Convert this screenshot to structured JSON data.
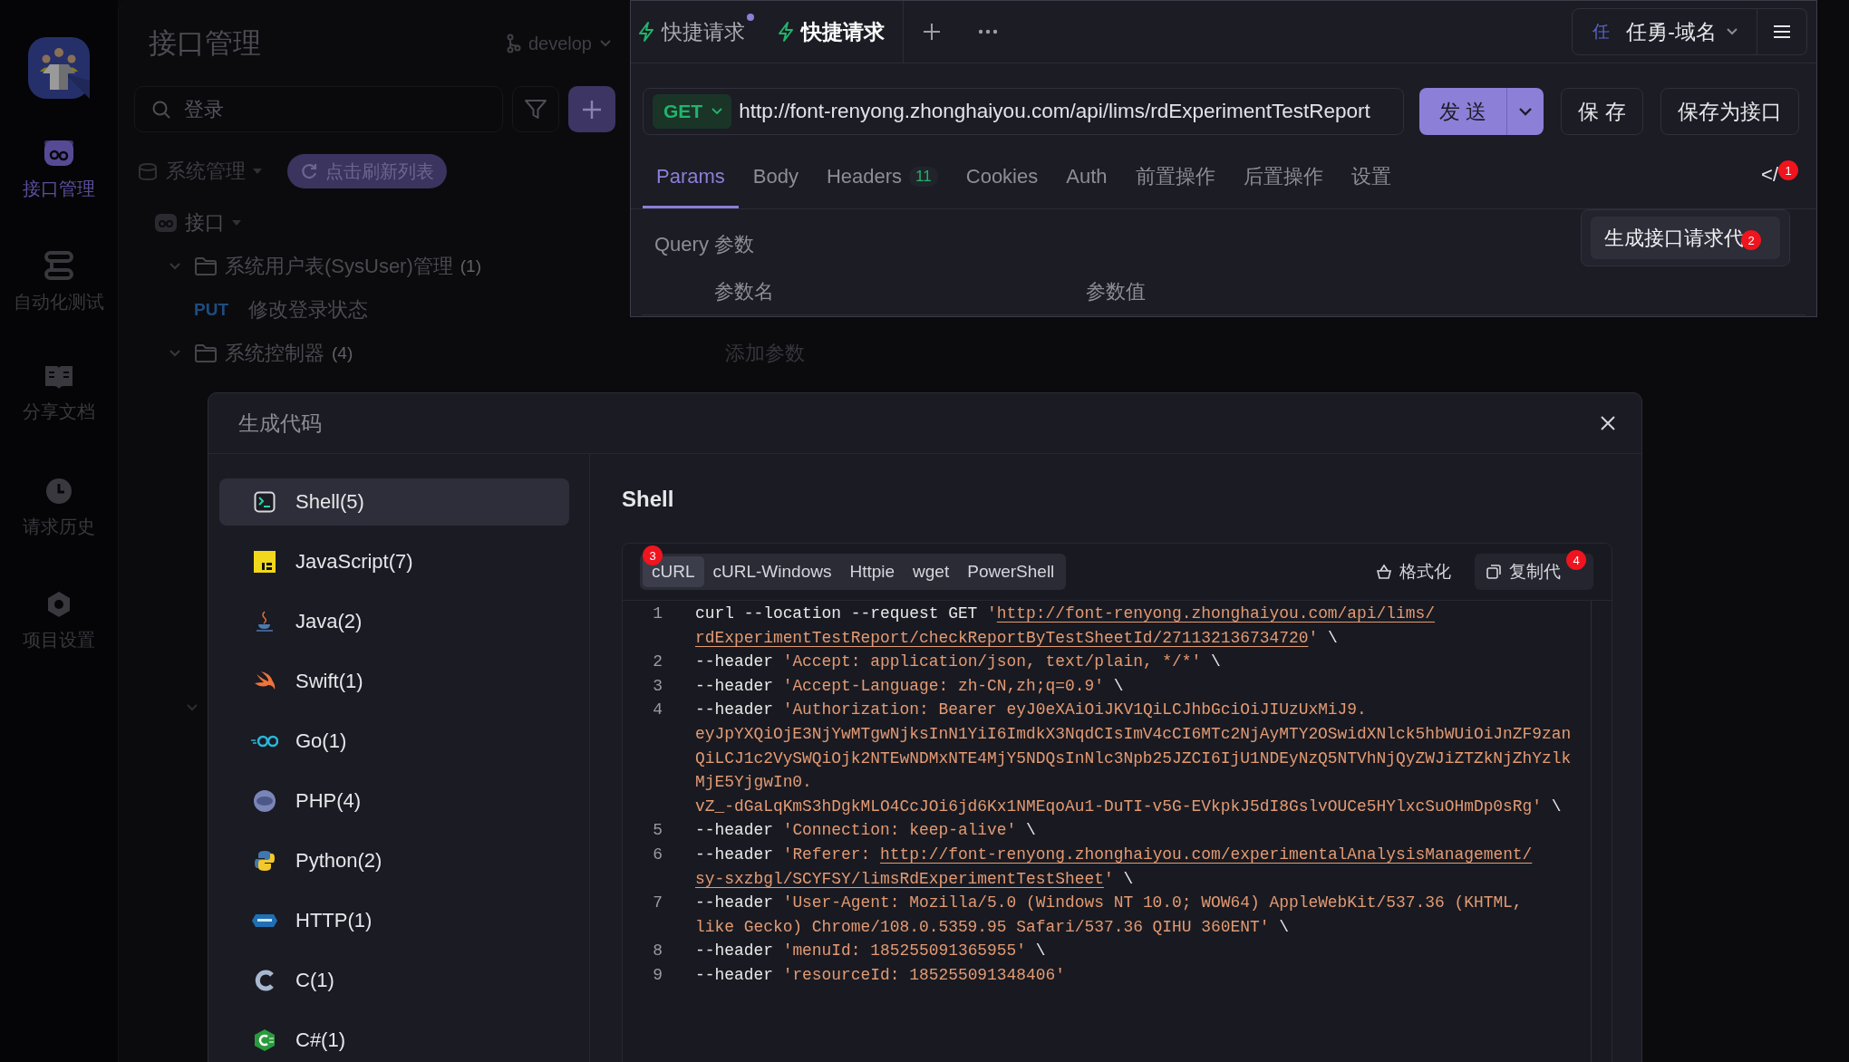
{
  "nav": {
    "items": [
      {
        "label": "接口管理",
        "kind": "api",
        "selected": true
      },
      {
        "label": "自动化测试",
        "kind": "automation",
        "selected": false
      },
      {
        "label": "分享文档",
        "kind": "docs",
        "selected": false
      },
      {
        "label": "请求历史",
        "kind": "history",
        "selected": false
      },
      {
        "label": "项目设置",
        "kind": "settings",
        "selected": false
      }
    ]
  },
  "tree_panel": {
    "title": "接口管理",
    "branch": "develop",
    "search": {
      "value": "登录"
    },
    "group": "系统管理",
    "refresh_button": "点击刷新列表",
    "root": "接口",
    "folders": [
      {
        "name": "系统用户表(SysUser)管理",
        "count": "(1)",
        "expanded": true,
        "children": [
          {
            "method": "PUT",
            "name": "修改登录状态"
          }
        ]
      },
      {
        "name": "系统控制器",
        "count": "(4)",
        "expanded": true
      }
    ]
  },
  "request": {
    "tabs": [
      {
        "label": "快捷请求",
        "selected": false,
        "unsaved": true
      },
      {
        "label": "快捷请求",
        "selected": true,
        "unsaved": false
      }
    ],
    "environment": {
      "avatar": "任",
      "name": "任勇-域名"
    },
    "method": "GET",
    "url": "http://font-renyong.zhonghaiyou.com/api/lims/rdExperimentTestReport",
    "send": "发 送",
    "save": "保 存",
    "save_as": "保存为接口",
    "param_tabs": [
      {
        "label": "Params",
        "selected": true
      },
      {
        "label": "Body",
        "selected": false
      },
      {
        "label": "Headers",
        "badge": "11",
        "selected": false
      },
      {
        "label": "Cookies",
        "selected": false
      },
      {
        "label": "Auth",
        "selected": false
      },
      {
        "label": "前置操作",
        "selected": false
      },
      {
        "label": "后置操作",
        "selected": false
      },
      {
        "label": "设置",
        "selected": false
      }
    ],
    "code_button": "</",
    "code_badge": "1",
    "menu_item": "生成接口请求代",
    "menu_badge": "2",
    "query_title": "Query 参数",
    "columns": [
      "参数名",
      "参数值"
    ],
    "add_param": "添加参数"
  },
  "modal": {
    "title": "生成代码",
    "languages": [
      {
        "label": "Shell(5)",
        "kind": "shell",
        "selected": true
      },
      {
        "label": "JavaScript(7)",
        "kind": "js",
        "selected": false
      },
      {
        "label": "Java(2)",
        "kind": "java",
        "selected": false
      },
      {
        "label": "Swift(1)",
        "kind": "swift",
        "selected": false
      },
      {
        "label": "Go(1)",
        "kind": "go",
        "selected": false
      },
      {
        "label": "PHP(4)",
        "kind": "php",
        "selected": false
      },
      {
        "label": "Python(2)",
        "kind": "python",
        "selected": false
      },
      {
        "label": "HTTP(1)",
        "kind": "http",
        "selected": false
      },
      {
        "label": "C(1)",
        "kind": "c",
        "selected": false
      },
      {
        "label": "C#(1)",
        "kind": "csharp",
        "selected": false
      }
    ],
    "heading": "Shell",
    "snippet_tabs": [
      {
        "label": "cURL",
        "selected": true
      },
      {
        "label": "cURL-Windows",
        "selected": false
      },
      {
        "label": "Httpie",
        "selected": false
      },
      {
        "label": "wget",
        "selected": false
      },
      {
        "label": "PowerShell",
        "selected": false
      }
    ],
    "snippet_badge": "3",
    "format_button": "格式化",
    "copy_button": "复制代",
    "copy_badge": "4",
    "code_lines": [
      {
        "number": "1",
        "segments": [
          {
            "kind": "plain",
            "text": "curl --location --request GET "
          },
          {
            "kind": "string",
            "text": "'"
          },
          {
            "kind": "link",
            "text": "http://font-renyong.zhonghaiyou.com/api/lims/",
            "wrap": true
          },
          {
            "kind": "link",
            "text": "rdExperimentTestReport/checkReportByTestSheetId/271132136734720"
          },
          {
            "kind": "string",
            "text": "'"
          },
          {
            "kind": "plain",
            "text": " \\"
          }
        ]
      },
      {
        "number": "2",
        "segments": [
          {
            "kind": "plain",
            "text": "--header "
          },
          {
            "kind": "string",
            "text": "'Accept: application/json, text/plain, */*'"
          },
          {
            "kind": "plain",
            "text": " \\"
          }
        ]
      },
      {
        "number": "3",
        "segments": [
          {
            "kind": "plain",
            "text": "--header "
          },
          {
            "kind": "string",
            "text": "'Accept-Language: zh-CN,zh;q=0.9'"
          },
          {
            "kind": "plain",
            "text": " \\"
          }
        ]
      },
      {
        "number": "4",
        "segments": [
          {
            "kind": "plain",
            "text": "--header "
          },
          {
            "kind": "string",
            "text": "'Authorization: Bearer eyJ0eXAiOiJKV1QiLCJhbGciOiJIUzUxMiJ9.",
            "wrap": true
          },
          {
            "kind": "string",
            "text": "eyJpYXQiOjE3NjYwMTgwNjksInN1YiI6ImdkX3NqdCIsImV4cCI6MTc2NjAyMTY2OSwidXNlck5hbWUiOiJnZF9zan",
            "wrap": true
          },
          {
            "kind": "string",
            "text": "QiLCJ1c2VySWQiOjk2NTEwNDMxNTE4MjY5NDQsInNlc3Npb25JZCI6IjU1NDEyNzQ5NTVhNjQyZWJiZTZkNjZhYzlk",
            "wrap": true
          },
          {
            "kind": "string",
            "text": "MjE5YjgwIn0.",
            "wrap": true
          },
          {
            "kind": "string",
            "text": "vZ_-dGaLqKmS3hDgkMLO4CcJOi6jd6Kx1NMEqoAu1-DuTI-v5G-EVkpkJ5dI8GslvOUCe5HYlxcSuOHmDp0sRg'"
          },
          {
            "kind": "plain",
            "text": " \\"
          }
        ]
      },
      {
        "number": "5",
        "segments": [
          {
            "kind": "plain",
            "text": "--header "
          },
          {
            "kind": "string",
            "text": "'Connection: keep-alive'"
          },
          {
            "kind": "plain",
            "text": " \\"
          }
        ]
      },
      {
        "number": "6",
        "segments": [
          {
            "kind": "plain",
            "text": "--header "
          },
          {
            "kind": "string",
            "text": "'Referer: "
          },
          {
            "kind": "link",
            "text": "http://font-renyong.zhonghaiyou.com/experimentalAnalysisManagement/",
            "wrap": true
          },
          {
            "kind": "link",
            "text": "sy-sxzbgl/SCYFSY/limsRdExperimentTestSheet"
          },
          {
            "kind": "string",
            "text": "'"
          },
          {
            "kind": "plain",
            "text": " \\"
          }
        ]
      },
      {
        "number": "7",
        "segments": [
          {
            "kind": "plain",
            "text": "--header "
          },
          {
            "kind": "string",
            "text": "'User-Agent: Mozilla/5.0 (Windows NT 10.0; WOW64) AppleWebKit/537.36 (KHTML,",
            "wrap": true
          },
          {
            "kind": "string",
            "text": "like Gecko) Chrome/108.0.5359.95 Safari/537.36 QIHU 360ENT'"
          },
          {
            "kind": "plain",
            "text": " \\"
          }
        ]
      },
      {
        "number": "8",
        "segments": [
          {
            "kind": "plain",
            "text": "--header "
          },
          {
            "kind": "string",
            "text": "'menuId: 185255091365955'"
          },
          {
            "kind": "plain",
            "text": " \\"
          }
        ]
      },
      {
        "number": "9",
        "segments": [
          {
            "kind": "plain",
            "text": "--header "
          },
          {
            "kind": "string",
            "text": "'resourceId: 185255091348406'"
          }
        ]
      }
    ]
  }
}
